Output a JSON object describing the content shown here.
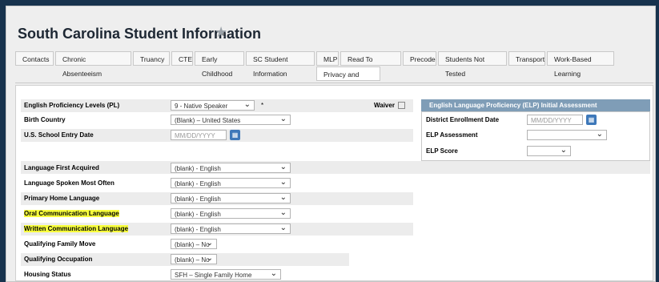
{
  "page": {
    "title": "South Carolina Student Information"
  },
  "tabs": [
    {
      "label": "Contacts"
    },
    {
      "label": "Chronic Absenteeism"
    },
    {
      "label": "Truancy"
    },
    {
      "label": "CTE"
    },
    {
      "label": "Early Childhood"
    },
    {
      "label": "SC Student Information"
    },
    {
      "label": "MLP"
    },
    {
      "label": "Read To Succeed"
    },
    {
      "label": "Precode"
    },
    {
      "label": "Students Not Tested"
    },
    {
      "label": "Transport"
    },
    {
      "label": "Work-Based Learning"
    },
    {
      "label": "Privacy and Security"
    }
  ],
  "form": {
    "rows": [
      {
        "label": "English Proficiency Levels (PL)",
        "value": "9 - Native Speaker"
      },
      {
        "label": "Birth Country",
        "value": "(Blank) – United States"
      },
      {
        "label": "U.S. School Entry Date",
        "value": "MM/DD/YYYY"
      },
      {
        "label": "Language First Acquired",
        "value": "(blank) - English"
      },
      {
        "label": "Language Spoken Most Often",
        "value": "(blank) - English"
      },
      {
        "label": "Primary Home Language",
        "value": "(blank) - English"
      },
      {
        "label": "Oral Communication Language",
        "value": "(blank) - English"
      },
      {
        "label": "Written Communication Language",
        "value": "(blank) - English"
      },
      {
        "label": "Qualifying Family Move",
        "value": "(blank) – No"
      },
      {
        "label": "Qualifying Occupation",
        "value": "(blank) – No"
      },
      {
        "label": "Housing Status",
        "value": "SFH – Single Family Home"
      }
    ],
    "waiver_label": "Waiver",
    "asterisk": "*"
  },
  "elp": {
    "title": "English Language Proficiency (ELP) Initial Assessment",
    "district_enrollment_date_label": "District Enrollment Date",
    "district_enrollment_date_placeholder": "MM/DD/YYYY",
    "assessment_label": "ELP Assessment",
    "score_label": "ELP Score"
  }
}
